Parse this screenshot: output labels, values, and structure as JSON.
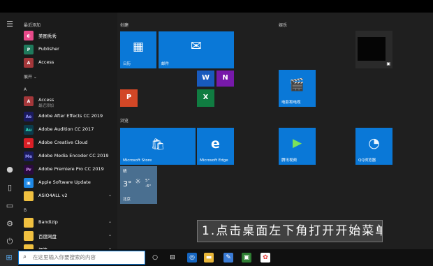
{
  "recent_section": {
    "label": "最近添加"
  },
  "expand": {
    "label": "展开 ⌄"
  },
  "recent_apps": [
    {
      "name": "美图秀秀",
      "color": "#e84a8a"
    },
    {
      "name": "Publisher",
      "color": "#1f7a5c"
    },
    {
      "name": "Access",
      "color": "#a4373a"
    }
  ],
  "letter_a": "A",
  "letter_b": "B",
  "apps_a": [
    {
      "name": "Access",
      "sub": "最近添加",
      "color": "#a4373a"
    },
    {
      "name": "Adobe After Effects CC 2019",
      "color": "#1a1a5e",
      "fg": "#9999ff"
    },
    {
      "name": "Adobe Audition CC 2017",
      "color": "#0b3a4a",
      "fg": "#33e0c0"
    },
    {
      "name": "Adobe Creative Cloud",
      "color": "#da1f26"
    },
    {
      "name": "Adobe Media Encoder CC 2019",
      "color": "#1a1a5e",
      "fg": "#9999ff"
    },
    {
      "name": "Adobe Premiere Pro CC 2019",
      "color": "#2a0a3e",
      "fg": "#e099ff"
    },
    {
      "name": "Apple Software Update",
      "color": "#1e88e5"
    },
    {
      "name": "ASIO4ALL v2",
      "color": "#f0c040",
      "chev": "⌄"
    }
  ],
  "apps_b": [
    {
      "name": "Bandizip",
      "color": "#f0c040",
      "chev": "⌄"
    },
    {
      "name": "百度网盘",
      "color": "#f0c040",
      "chev": "⌄"
    },
    {
      "name": "便笺",
      "color": "#f0c040",
      "chev": "⌄"
    }
  ],
  "groups": {
    "create": "创建",
    "browse": "浏览",
    "entertainment": "娱乐"
  },
  "tiles": {
    "calendar": "日历",
    "mail": "邮件",
    "store": "Microsoft Store",
    "edge": "Microsoft Edge",
    "weather_city": "北京",
    "weather_title": "晴",
    "weather_temp": "3°",
    "weather_high": "5°",
    "weather_low": "-6°",
    "movies": "电影和电视",
    "tencent_video": "腾讯视频",
    "qq_browser": "QQ浏览器"
  },
  "caption": "1.点击桌面左下角打开开始菜单",
  "search": {
    "placeholder": "在这里输入你要搜索的内容"
  },
  "colors": {
    "accent": "#0a78d7",
    "tile_bg": "#1f1f1f"
  }
}
